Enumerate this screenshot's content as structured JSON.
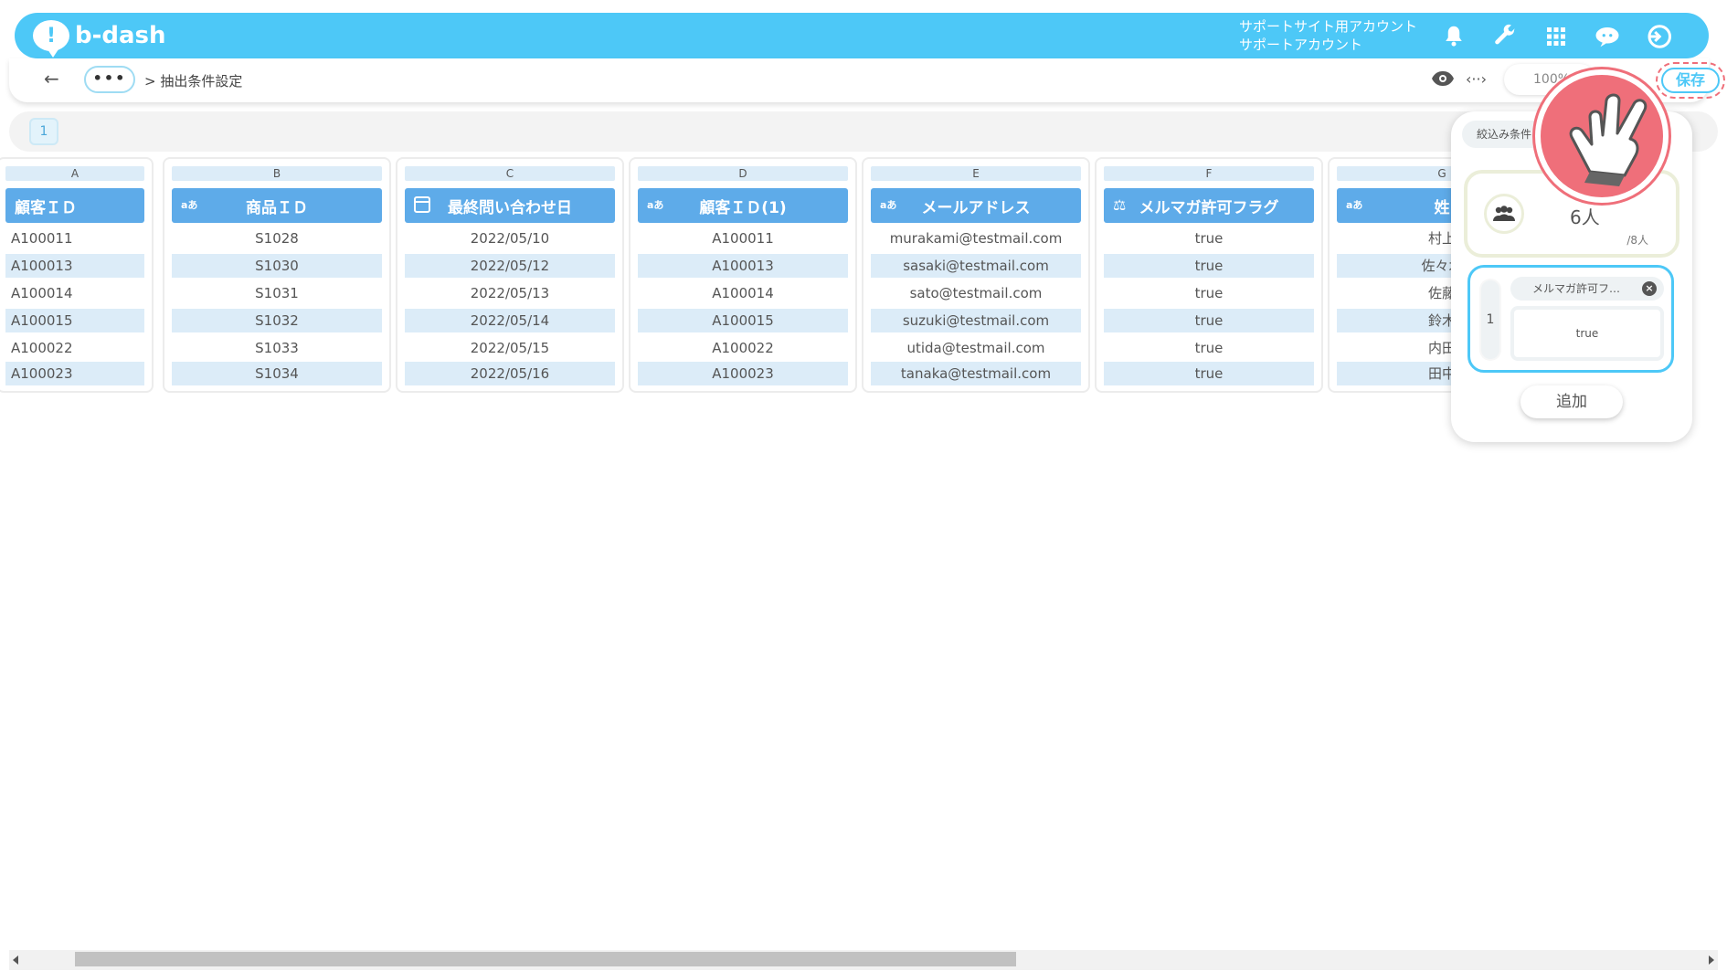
{
  "header": {
    "logo_text": "b-dash",
    "account_line1": "サポートサイト用アカウント",
    "account_line2": "サポートアカウント",
    "icons": [
      "bell-icon",
      "wrench-icon",
      "grid-icon",
      "chat-icon",
      "logout-icon"
    ]
  },
  "subbar": {
    "dots": "•••",
    "breadcrumb": "> 抽出条件設定",
    "zoom": "100%",
    "save_label": "保存"
  },
  "pages": [
    "1"
  ],
  "table": {
    "columns": [
      {
        "letter": "A",
        "header": "顧客ＩＤ",
        "type": "text"
      },
      {
        "letter": "B",
        "header": "商品ＩＤ",
        "type": "text"
      },
      {
        "letter": "C",
        "header": "最終問い合わせ日",
        "type": "date"
      },
      {
        "letter": "D",
        "header": "顧客ＩＤ(1)",
        "type": "text"
      },
      {
        "letter": "E",
        "header": "メールアドレス",
        "type": "text"
      },
      {
        "letter": "F",
        "header": "メルマガ許可フラグ",
        "type": "flag"
      },
      {
        "letter": "G",
        "header": "姓",
        "type": "text"
      }
    ],
    "type_icon_text": "aあ",
    "rows": [
      [
        "A100011",
        "S1028",
        "2022/05/10",
        "A100011",
        "murakami@testmail.com",
        "true",
        "村上"
      ],
      [
        "A100013",
        "S1030",
        "2022/05/12",
        "A100013",
        "sasaki@testmail.com",
        "true",
        "佐々木"
      ],
      [
        "A100014",
        "S1031",
        "2022/05/13",
        "A100014",
        "sato@testmail.com",
        "true",
        "佐藤"
      ],
      [
        "A100015",
        "S1032",
        "2022/05/14",
        "A100015",
        "suzuki@testmail.com",
        "true",
        "鈴木"
      ],
      [
        "A100022",
        "S1033",
        "2022/05/15",
        "A100022",
        "utida@testmail.com",
        "true",
        "内田"
      ],
      [
        "A100023",
        "S1034",
        "2022/05/16",
        "A100023",
        "tanaka@testmail.com",
        "true",
        "田中"
      ]
    ]
  },
  "filter_panel": {
    "tab_label": "絞込み条件",
    "count": "6人",
    "total": "/8人",
    "condition": {
      "index": "1",
      "field": "メルマガ許可フ…",
      "value": "true"
    },
    "add_label": "追加"
  },
  "colors": {
    "brand": "#4dc8f7",
    "header_cell": "#5eabe9",
    "alt_row": "#dcecf8",
    "pointer": "#ef6f7a"
  }
}
